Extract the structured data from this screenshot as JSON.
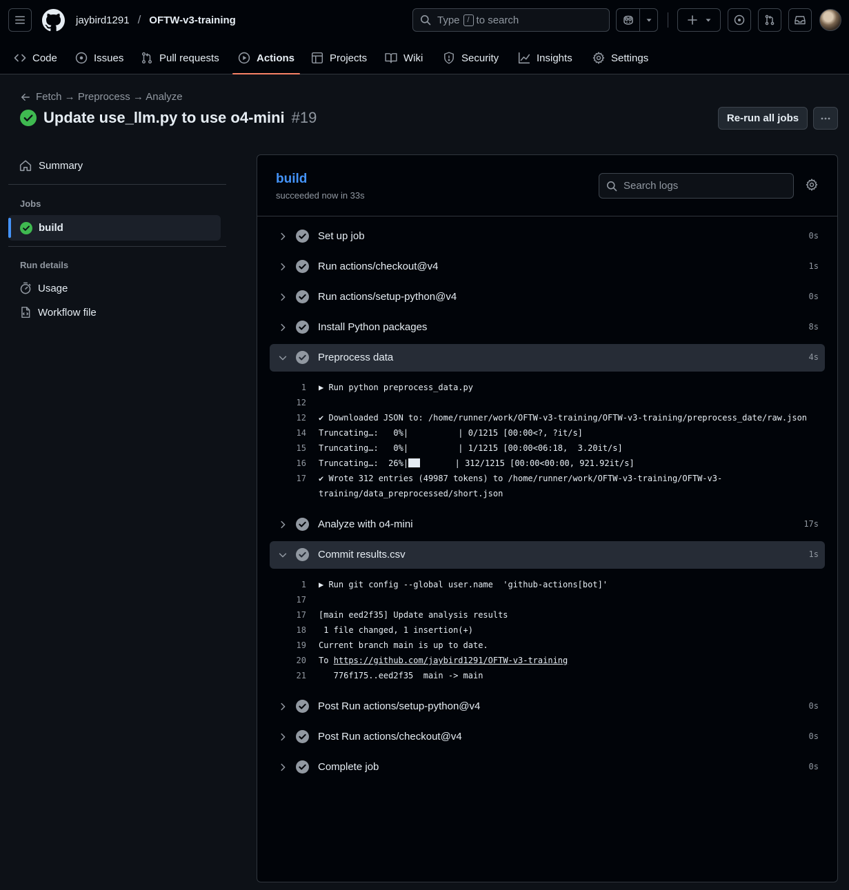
{
  "header": {
    "repo_owner": "jaybird1291",
    "repo_name": "OFTW-v3-training",
    "search_prefix": "Type",
    "search_key": "/",
    "search_suffix": "to search"
  },
  "nav": {
    "tabs": [
      {
        "label": "Code",
        "icon": "code-icon"
      },
      {
        "label": "Issues",
        "icon": "issue-opened-icon"
      },
      {
        "label": "Pull requests",
        "icon": "git-pull-request-icon"
      },
      {
        "label": "Actions",
        "icon": "play-icon",
        "active": true
      },
      {
        "label": "Projects",
        "icon": "table-icon"
      },
      {
        "label": "Wiki",
        "icon": "book-icon"
      },
      {
        "label": "Security",
        "icon": "shield-icon"
      },
      {
        "label": "Insights",
        "icon": "graph-icon"
      },
      {
        "label": "Settings",
        "icon": "gear-icon"
      }
    ]
  },
  "run": {
    "breadcrumb": "Fetch → Preprocess → Analyze",
    "title": "Update use_llm.py to use o4-mini",
    "number": "#19",
    "rerun_label": "Re-run all jobs"
  },
  "sidebar": {
    "summary_label": "Summary",
    "jobs_heading": "Jobs",
    "job_label": "build",
    "run_details_heading": "Run details",
    "usage_label": "Usage",
    "workflow_file_label": "Workflow file"
  },
  "job": {
    "name": "build",
    "status": "succeeded now in 33s",
    "search_placeholder": "Search logs",
    "steps": [
      {
        "label": "Set up job",
        "duration": "0s"
      },
      {
        "label": "Run actions/checkout@v4",
        "duration": "1s"
      },
      {
        "label": "Run actions/setup-python@v4",
        "duration": "0s"
      },
      {
        "label": "Install Python packages",
        "duration": "8s"
      },
      {
        "label": "Preprocess data",
        "duration": "4s",
        "expanded": true
      },
      {
        "label": "Analyze with o4-mini",
        "duration": "17s"
      },
      {
        "label": "Commit results.csv",
        "duration": "1s",
        "expanded": true
      },
      {
        "label": "Post Run actions/setup-python@v4",
        "duration": "0s"
      },
      {
        "label": "Post Run actions/checkout@v4",
        "duration": "0s"
      },
      {
        "label": "Complete job",
        "duration": "0s"
      }
    ],
    "preprocess_log": [
      {
        "n": "1",
        "text": "▶ Run python preprocess_data.py"
      },
      {
        "n": "12",
        "text": ""
      },
      {
        "n": "12",
        "text": "✔ Downloaded JSON to: /home/runner/work/OFTW-v3-training/OFTW-v3-training/preprocess_date/raw.json"
      },
      {
        "n": "14",
        "text": "Truncating…:   0%|          | 0/1215 [00:00<?, ?it/s]"
      },
      {
        "n": "15",
        "text": "Truncating…:   0%|          | 1/1215 [00:00<06:18,  3.20it/s]"
      },
      {
        "n": "16",
        "text_a": "Truncating…:  26%|",
        "text_b": "       | 312/1215 [00:00<00:00, 921.92it/s]"
      },
      {
        "n": "17",
        "text": "✔ Wrote 312 entries (49987 tokens) to /home/runner/work/OFTW-v3-training/OFTW-v3-"
      },
      {
        "n": "",
        "text": "training/data_preprocessed/short.json"
      }
    ],
    "commit_log": [
      {
        "n": "1",
        "text": "▶ Run git config --global user.name  'github-actions[bot]'"
      },
      {
        "n": "17",
        "text": ""
      },
      {
        "n": "17",
        "text": "[main eed2f35] Update analysis results"
      },
      {
        "n": "18",
        "text": " 1 file changed, 1 insertion(+)"
      },
      {
        "n": "19",
        "text": "Current branch main is up to date."
      },
      {
        "n": "20",
        "text_prefix": "To ",
        "link": "https://github.com/jaybird1291/OFTW-v3-training"
      },
      {
        "n": "21",
        "text": "   776f175..eed2f35  main -> main"
      }
    ]
  },
  "colors": {
    "success": "#3fb950",
    "accent": "#4493f8",
    "active_tab_underline": "#f78166",
    "step_check": "#9198a1"
  }
}
